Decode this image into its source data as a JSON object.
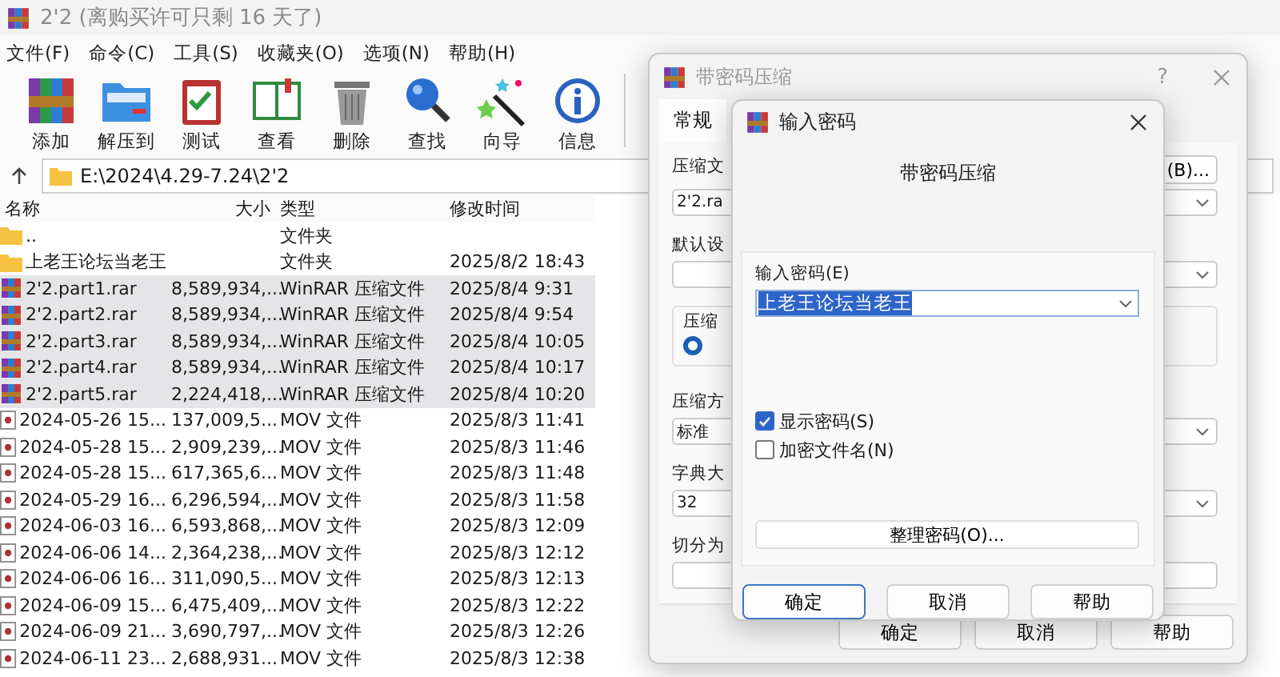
{
  "window": {
    "title": "2'2 (离购买许可只剩 16 天了)"
  },
  "menu": [
    "文件(F)",
    "命令(C)",
    "工具(S)",
    "收藏夹(O)",
    "选项(N)",
    "帮助(H)"
  ],
  "toolbar": [
    {
      "kind": "add",
      "label": "添加"
    },
    {
      "kind": "extract",
      "label": "解压到"
    },
    {
      "kind": "test",
      "label": "测试"
    },
    {
      "kind": "view",
      "label": "查看"
    },
    {
      "kind": "delete",
      "label": "删除"
    },
    {
      "kind": "find",
      "label": "查找"
    },
    {
      "kind": "wizard",
      "label": "向导"
    },
    {
      "kind": "info",
      "label": "信息"
    }
  ],
  "address": {
    "path": "E:\\2024\\4.29-7.24\\2'2"
  },
  "table": {
    "columns": [
      "名称",
      "大小",
      "类型",
      "修改时间"
    ],
    "rows": [
      {
        "kind": "folder",
        "name": "..",
        "type": "文件夹",
        "selected": false
      },
      {
        "kind": "folder",
        "name": "上老王论坛当老王",
        "type": "文件夹",
        "modified": "2025/8/2 18:43",
        "selected": false
      },
      {
        "kind": "rar",
        "name": "2'2.part1.rar",
        "size": "8,589,934,...",
        "type": "WinRAR 压缩文件",
        "modified": "2025/8/4 9:31",
        "selected": true
      },
      {
        "kind": "rar",
        "name": "2'2.part2.rar",
        "size": "8,589,934,...",
        "type": "WinRAR 压缩文件",
        "modified": "2025/8/4 9:54",
        "selected": true
      },
      {
        "kind": "rar",
        "name": "2'2.part3.rar",
        "size": "8,589,934,...",
        "type": "WinRAR 压缩文件",
        "modified": "2025/8/4 10:05",
        "selected": true
      },
      {
        "kind": "rar",
        "name": "2'2.part4.rar",
        "size": "8,589,934,...",
        "type": "WinRAR 压缩文件",
        "modified": "2025/8/4 10:17",
        "selected": true
      },
      {
        "kind": "rar",
        "name": "2'2.part5.rar",
        "size": "2,224,418,...",
        "type": "WinRAR 压缩文件",
        "modified": "2025/8/4 10:20",
        "selected": true
      },
      {
        "kind": "mov",
        "name": "2024-05-26 15...",
        "size": "137,009,5...",
        "type": "MOV 文件",
        "modified": "2025/8/3 11:41",
        "selected": false
      },
      {
        "kind": "mov",
        "name": "2024-05-28 15...",
        "size": "2,909,239,...",
        "type": "MOV 文件",
        "modified": "2025/8/3 11:46",
        "selected": false
      },
      {
        "kind": "mov",
        "name": "2024-05-28 15...",
        "size": "617,365,6...",
        "type": "MOV 文件",
        "modified": "2025/8/3 11:48",
        "selected": false
      },
      {
        "kind": "mov",
        "name": "2024-05-29 16...",
        "size": "6,296,594,...",
        "type": "MOV 文件",
        "modified": "2025/8/3 11:58",
        "selected": false
      },
      {
        "kind": "mov",
        "name": "2024-06-03 16...",
        "size": "6,593,868,...",
        "type": "MOV 文件",
        "modified": "2025/8/3 12:09",
        "selected": false
      },
      {
        "kind": "mov",
        "name": "2024-06-06 14...",
        "size": "2,364,238,...",
        "type": "MOV 文件",
        "modified": "2025/8/3 12:12",
        "selected": false
      },
      {
        "kind": "mov",
        "name": "2024-06-06 16...",
        "size": "311,090,5...",
        "type": "MOV 文件",
        "modified": "2025/8/3 12:13",
        "selected": false
      },
      {
        "kind": "mov",
        "name": "2024-06-09 15...",
        "size": "6,475,409,...",
        "type": "MOV 文件",
        "modified": "2025/8/3 12:22",
        "selected": false
      },
      {
        "kind": "mov",
        "name": "2024-06-09 21...",
        "size": "3,690,797,...",
        "type": "MOV 文件",
        "modified": "2025/8/3 12:26",
        "selected": false
      },
      {
        "kind": "mov",
        "name": "2024-06-11 23...",
        "size": "2,688,931...",
        "type": "MOV 文件",
        "modified": "2025/8/3 12:38",
        "selected": false
      }
    ]
  },
  "archive_dialog": {
    "title": "带密码压缩",
    "help": "?",
    "tabs": [
      {
        "label": "常规",
        "selected": true
      }
    ],
    "archive_label": "压缩文",
    "browse_button": "(B)...",
    "archive_name": "2'2.ra",
    "profile_label": "默认设",
    "group_label": "压缩",
    "radio_selected": true,
    "method_label": "压缩方",
    "method": "标准",
    "dictionary_label": "字典大",
    "dictionary": "32",
    "split_label": "切分为",
    "buttons": [
      "确定",
      "取消",
      "帮助"
    ]
  },
  "password_dialog": {
    "title": "输入密码",
    "heading": "带密码压缩",
    "password_label": "输入密码(E)",
    "password": "上老王论坛当老王",
    "password_selected": true,
    "checkboxes": [
      {
        "label": "显示密码(S)",
        "checked": true
      },
      {
        "label": "加密文件名(N)",
        "checked": false
      }
    ],
    "organize_button": "整理密码(O)...",
    "buttons": [
      {
        "label": "确定",
        "default": true
      },
      {
        "label": "取消",
        "default": false
      },
      {
        "label": "帮助",
        "default": false
      }
    ]
  }
}
